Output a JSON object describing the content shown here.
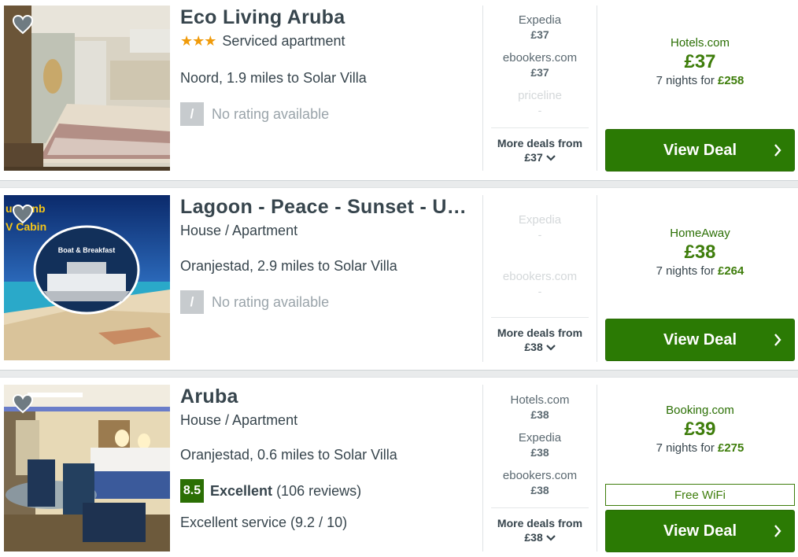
{
  "colors": {
    "brand_green": "#2b7a04",
    "price_green": "#3e7d0b",
    "star": "#f09b0b"
  },
  "listings": [
    {
      "title": "Eco Living Aruba",
      "stars": "★★★",
      "type": "Serviced apartment",
      "location": "Noord, 1.9 miles to Solar Villa",
      "rating_badge": "/",
      "rating_text": "No rating available",
      "deals": [
        {
          "provider": "Expedia",
          "price": "£37"
        },
        {
          "provider": "ebookers.com",
          "price": "£37"
        },
        {
          "provider": "priceline",
          "price": "-"
        }
      ],
      "more_deals_label": "More deals from",
      "more_deals_price": "£37",
      "best_provider": "Hotels.com",
      "best_price": "£37",
      "nights_text": "7 nights for",
      "nights_total": "£258",
      "button": "View Deal"
    },
    {
      "title": "Lagoon - Peace - Sunset - Unique",
      "type": "House / Apartment",
      "location": "Oranjestad, 2.9 miles to Solar Villa",
      "rating_badge": "/",
      "rating_text": "No rating available",
      "photo_text_1": "uuabnb",
      "photo_text_2": "V Cabin",
      "photo_text_3": "Boat & Breakfast",
      "deals": [
        {
          "provider": "Expedia",
          "price": "-"
        },
        {
          "provider": "ebookers.com",
          "price": "-"
        }
      ],
      "more_deals_label": "More deals from",
      "more_deals_price": "£38",
      "best_provider": "HomeAway",
      "best_price": "£38",
      "nights_text": "7 nights for",
      "nights_total": "£264",
      "button": "View Deal"
    },
    {
      "title": "Aruba",
      "type": "House / Apartment",
      "location": "Oranjestad, 0.6 miles to Solar Villa",
      "score": "8.5",
      "score_label": "Excellent",
      "reviews": "(106 reviews)",
      "extra": "Excellent service (9.2 / 10)",
      "deals": [
        {
          "provider": "Hotels.com",
          "price": "£38"
        },
        {
          "provider": "Expedia",
          "price": "£38"
        },
        {
          "provider": "ebookers.com",
          "price": "£38"
        }
      ],
      "more_deals_label": "More deals from",
      "more_deals_price": "£38",
      "best_provider": "Booking.com",
      "best_price": "£39",
      "nights_text": "7 nights for",
      "nights_total": "£275",
      "amenity": "Free WiFi",
      "button": "View Deal"
    }
  ]
}
